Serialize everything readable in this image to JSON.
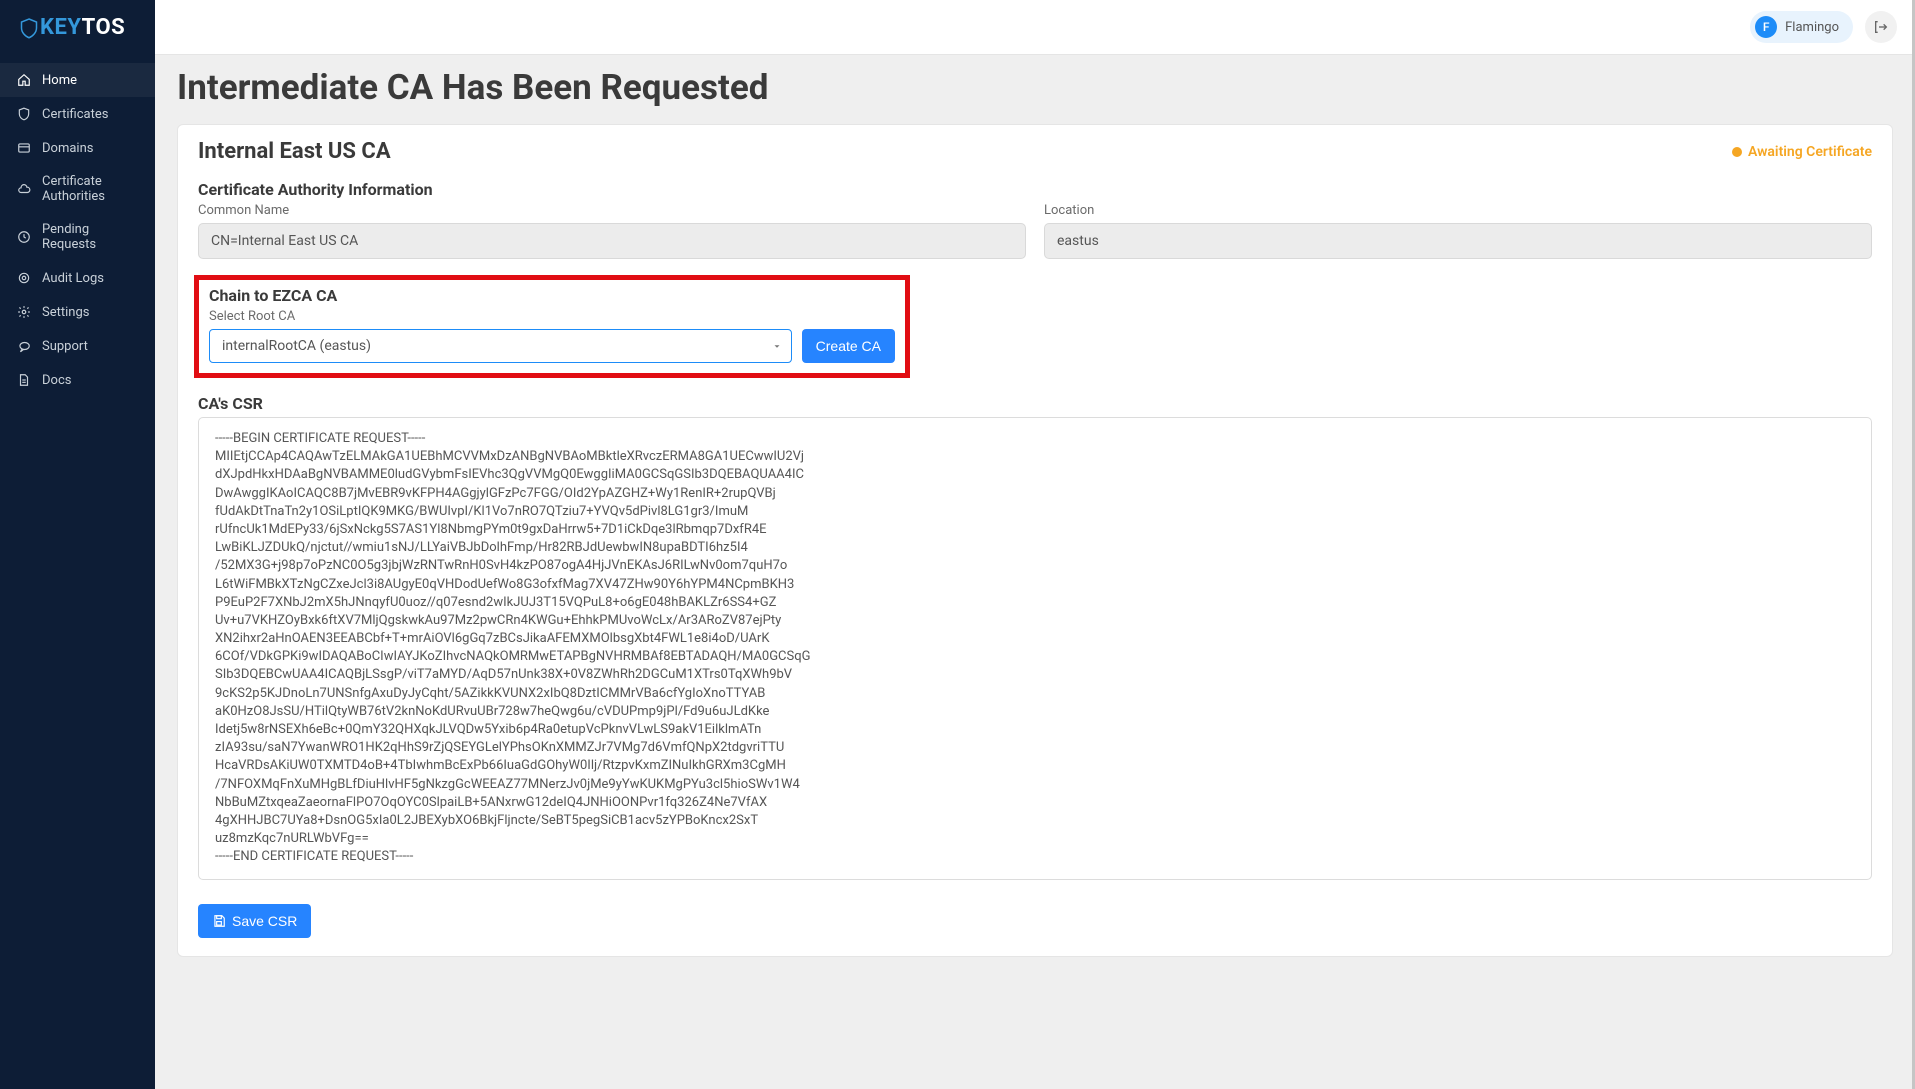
{
  "brand": {
    "key": "KEY",
    "tos": "TOS"
  },
  "nav": [
    {
      "label": "Home",
      "icon": "home"
    },
    {
      "label": "Certificates",
      "icon": "shield"
    },
    {
      "label": "Domains",
      "icon": "card"
    },
    {
      "label": "Certificate Authorities",
      "icon": "cloud"
    },
    {
      "label": "Pending Requests",
      "icon": "clock"
    },
    {
      "label": "Audit Logs",
      "icon": "target"
    },
    {
      "label": "Settings",
      "icon": "gear"
    },
    {
      "label": "Support",
      "icon": "chat"
    },
    {
      "label": "Docs",
      "icon": "doc"
    }
  ],
  "user": {
    "initial": "F",
    "name": "Flamingo"
  },
  "page": {
    "title": "Intermediate CA Has Been Requested"
  },
  "ca": {
    "name": "Internal East US CA",
    "status": "Awaiting Certificate"
  },
  "info": {
    "section_title": "Certificate Authority Information",
    "common_name_label": "Common Name",
    "common_name_value": "CN=Internal East US CA",
    "location_label": "Location",
    "location_value": "eastus"
  },
  "chain": {
    "section_title": "Chain to EZCA CA",
    "select_label": "Select Root CA",
    "selected": "internalRootCA (eastus)",
    "button": "Create CA"
  },
  "csr": {
    "title": "CA's CSR",
    "text": "-----BEGIN CERTIFICATE REQUEST-----\nMIIEtjCCAp4CAQAwTzELMAkGA1UEBhMCVVMxDzANBgNVBAoMBktleXRvczERMA8GA1UECwwIU2Vj\ndXJpdHkxHDAaBgNVBAMME0ludGVybmFsIEVhc3QgVVMgQ0EwggIiMA0GCSqGSIb3DQEBAQUAA4IC\nDwAwggIKAoICAQC8B7jMvEBR9vKFPH4AGgjylGFzPc7FGG/OId2YpAZGHZ+Wy1RenIR+2rupQVBj\nfUdAkDtTnaTn2y1OSiLptIQK9MKG/BWUIvpI/Kl1Vo7nRO7QTziu7+YVQv5dPivl8LG1gr3/ImuM\nrUfncUk1MdEPy33/6jSxNckg5S7AS1Yl8NbmgPYm0t9gxDaHrrw5+7D1iCkDqe3lRbmqp7DxfR4E\nLwBiKLJZDUkQ/njctut//wmiu1sNJ/LLYaiVBJbDolhFmp/Hr82RBJdUewbwIN8upaBDTI6hz5I4\n/52MX3G+j98p7oPzNC0O5g3jbjWzRNTwRnH0SvH4kzPO87ogA4HjJVnEKAsJ6RILwNv0om7quH7o\nL6tWiFMBkXTzNgCZxeJcl3i8AUgyE0qVHDodUefWo8G3ofxfMag7XV47ZHw90Y6hYPM4NCpmBKH3\nP9EuP2F7XNbJ2mX5hJNnqyfU0uoz//q07esnd2wIkJUJ3T15VQPuL8+o6gE048hBAKLZr6SS4+GZ\nUv+u7VKHZOyBxk6ftXV7MljQgskwkAu97Mz2pwCRn4KWGu+EhhkPMUvoWcLx/Ar3ARoZV87ejPty\nXN2ihxr2aHnOAEN3EEABCbf+T+mrAiOVl6gGq7zBCsJikaAFEMXMOlbsgXbt4FWL1e8i4oD/UArK\n6COf/VDkGPKi9wIDAQABoCIwIAYJKoZIhvcNAQkOMRMwETAPBgNVHRMBAf8EBTADAQH/MA0GCSqG\nSIb3DQEBCwUAA4ICAQBjLSsgP/viT7aMYD/AqD57nUnk38X+0V8ZWhRh2DGCuM1XTrs0TqXWh9bV\n9cKS2p5KJDnoLn7UNSnfgAxuDyJyCqht/5AZikkKVUNX2xIbQ8DztICMMrVBa6cfYgIoXnoTTYAB\naK0HzO8JsSU/HTilQtyWB76tV2knNoKdURvuUBr728w7heQwg6u/cVDUPmp9jPl/Fd9u6uJLdKke\nIdetj5w8rNSEXh6eBc+0QmY32QHXqkJLVQDw5Yxib6p4Ra0etupVcPknvVLwLS9akV1EilklmATn\nzIA93su/saN7YwanWRO1HK2qHhS9rZjQSEYGLelYPhsOKnXMMZJr7VMg7d6VmfQNpX2tdgvriTTU\nHcaVRDsAKiUW0TXMTD4oB+4TbIwhmBcExPb66IuaGdGOhyW0Ilj/RtzpvKxmZINuIkhGRXm3CgMH\n/7NFOXMqFnXuMHgBLfDiuHlvHF5gNkzgGcWEEAZ77MNerzJv0jMe9yYwKUKMgPYu3cl5hioSWv1W4\nNbBuMZtxqeaZaeornaFlPO7OqOYC0SlpaiLB+5ANxrwG12deIQ4JNHiOONPvr1fq326Z4Ne7VfAX\n4gXHHJBC7UYa8+DsnOG5xIa0L2JBEXybXO6BkjFljncte/SeBT5pegSiCB1acv5zYPBoKncx2SxT\nuz8mzKqc7nURLWbVFg==\n-----END CERTIFICATE REQUEST-----",
    "save_button": "Save CSR"
  }
}
